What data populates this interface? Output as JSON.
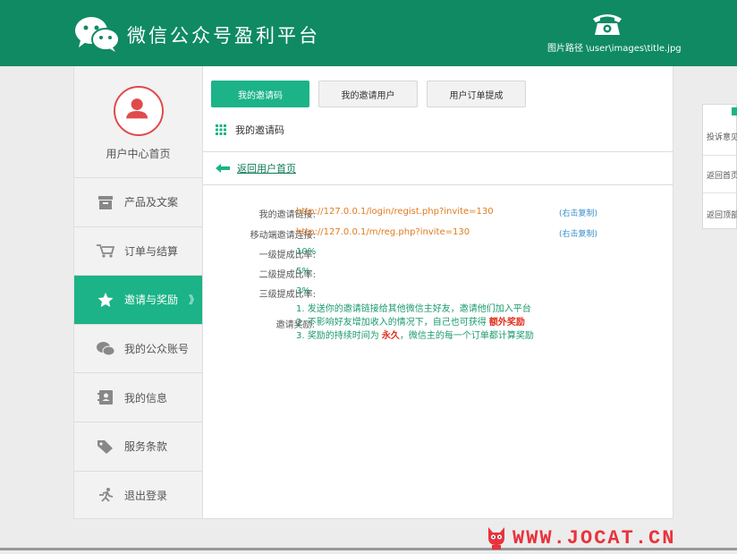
{
  "header": {
    "title": "微信公众号盈利平台",
    "image_path": "图片路径 \\user\\images\\title.jpg"
  },
  "sidebar": {
    "user_center": "用户中心首页",
    "items": [
      {
        "label": "产品及文案",
        "icon": "archive-box-icon"
      },
      {
        "label": "订单与结算",
        "icon": "shopping-cart-icon"
      },
      {
        "label": "邀请与奖励",
        "icon": "star-icon",
        "active": true,
        "chevron": "》"
      },
      {
        "label": "我的公众账号",
        "icon": "wechat-icon"
      },
      {
        "label": "我的信息",
        "icon": "contact-card-icon"
      },
      {
        "label": "服务条款",
        "icon": "tag-icon"
      },
      {
        "label": "退出登录",
        "icon": "running-person-icon"
      }
    ]
  },
  "main": {
    "tabs": [
      {
        "label": "我的邀请码",
        "active": true
      },
      {
        "label": "我的邀请用户",
        "active": false
      },
      {
        "label": "用户订单提成",
        "active": false
      }
    ],
    "section_title": "我的邀请码",
    "back_link": "返回用户首页",
    "rows": {
      "invite_link_label": "我的邀请链接:",
      "invite_link": "http://127.0.0.1/login/regist.php?invite=130",
      "mobile_link_label": "移动端邀请连接:",
      "mobile_link": "http://127.0.0.1/m/reg.php?invite=130",
      "copy_label": "(右击复制)",
      "level1_label": "一级提成比率:",
      "level1_value": "10%",
      "level2_label": "二级提成比率:",
      "level2_value": "5%",
      "level3_label": "三级提成比率:",
      "level3_value": "3%",
      "reward_label": "邀请奖励:",
      "reward_line1": "1. 发送你的邀请链接给其他微信主好友，邀请他们加入平台",
      "reward_line2_pre": "2. 不影响好友增加收入的情况下，自己也可获得",
      "reward_line2_hl": "额外奖励",
      "reward_line3_pre": "3. 奖励的持续时间为",
      "reward_line3_hl": "永久",
      "reward_line3_post": "，微信主的每一个订单都计算奖励"
    }
  },
  "float_panel": {
    "items": [
      "投诉意见",
      "返回首页",
      "返回顶部"
    ]
  },
  "watermark": "WWW.JOCAT.CN",
  "colors": {
    "header": "#0f8a63",
    "accent": "#1bb387",
    "link_orange": "#e07a1f",
    "highlight_red": "#e0301e"
  }
}
